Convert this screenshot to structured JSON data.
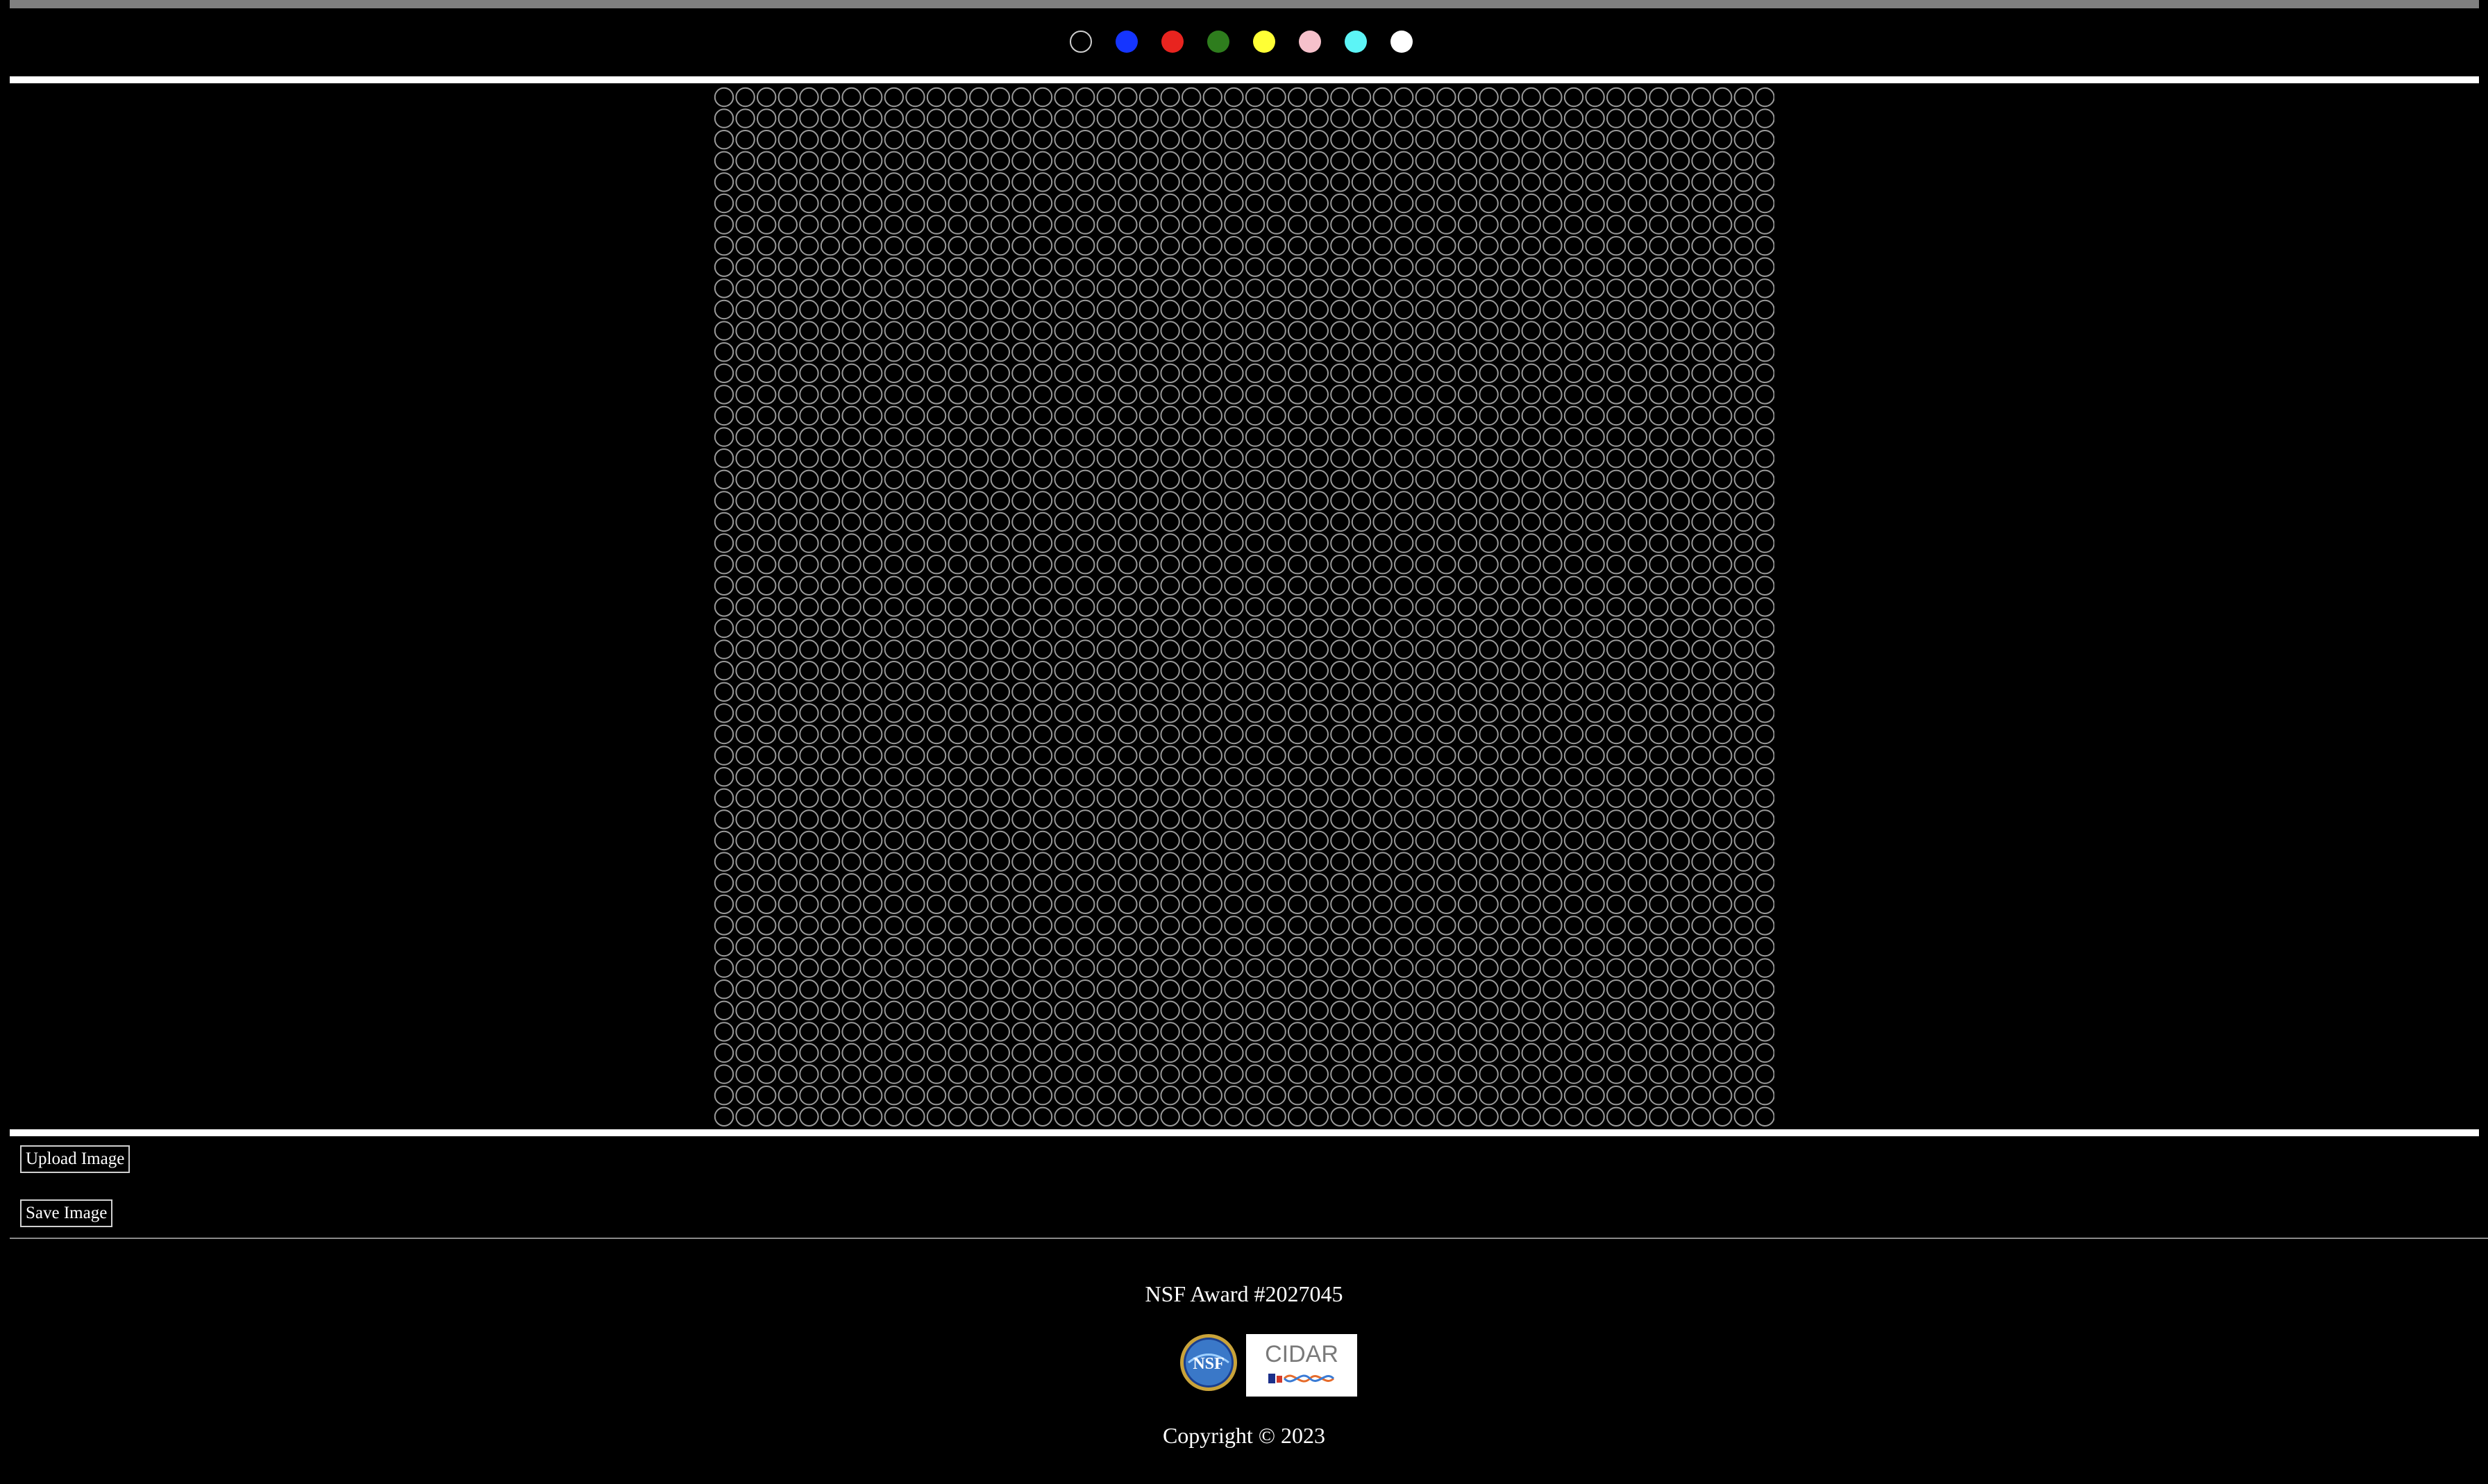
{
  "palette": {
    "colors": [
      {
        "name": "black",
        "hex": "#000000"
      },
      {
        "name": "blue",
        "hex": "#1535ff"
      },
      {
        "name": "red",
        "hex": "#e8241f"
      },
      {
        "name": "green",
        "hex": "#2e7d1d"
      },
      {
        "name": "yellow",
        "hex": "#ffff35"
      },
      {
        "name": "pink",
        "hex": "#f6c1cb"
      },
      {
        "name": "cyan",
        "hex": "#5cf4f6"
      },
      {
        "name": "white",
        "hex": "#ffffff"
      }
    ]
  },
  "grid": {
    "columns": 50,
    "rows": 49,
    "cell_stroke": "#9a9a9a",
    "cell_fill": "#000000"
  },
  "buttons": {
    "upload_label": "Upload Image",
    "save_label": "Save Image"
  },
  "footer": {
    "award_text": "NSF Award #2027045",
    "nsf_logo_text": "NSF",
    "cidar_logo_text": "CIDAR",
    "copyright_text": "Copyright © 2023"
  }
}
